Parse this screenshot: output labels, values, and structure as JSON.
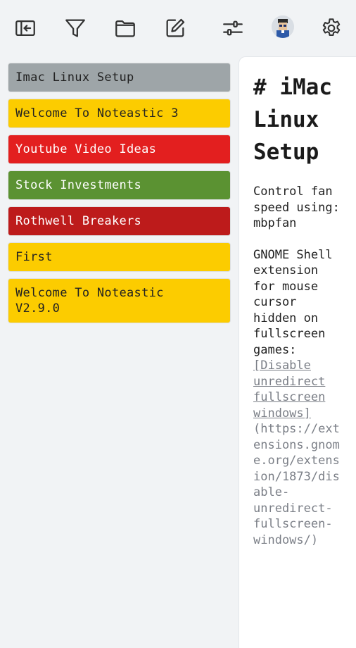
{
  "toolbar": {
    "icons": [
      "sidebar-collapse-icon",
      "filter-icon",
      "folder-icon",
      "edit-note-icon",
      "sliders-icon",
      "avatar",
      "gear-icon"
    ],
    "icon_color": "#333333"
  },
  "notes": [
    {
      "title": "Imac Linux Setup",
      "color": "#9ea5a8",
      "text_color": "#222222"
    },
    {
      "title": "Welcome To Noteastic 3",
      "color": "#fccc00",
      "text_color": "#222222"
    },
    {
      "title": "Youtube Video Ideas",
      "color": "#e31f1f",
      "text_color": "#ffffff"
    },
    {
      "title": "Stock Investments",
      "color": "#5b9232",
      "text_color": "#ffffff"
    },
    {
      "title": "Rothwell Breakers",
      "color": "#bd1b1b",
      "text_color": "#ffffff"
    },
    {
      "title": "First",
      "color": "#fccc00",
      "text_color": "#222222"
    },
    {
      "title": "Welcome To Noteastic\nV2.9.0",
      "color": "#fccc00",
      "text_color": "#222222"
    }
  ],
  "detail": {
    "heading": "# iMac Linux Setup",
    "para1": "Control fan speed using: mbpfan",
    "para2_text": "GNOME Shell extension for mouse cursor hidden on fullscreen games:",
    "link_text": "[Disable unredirect fullscreen windows]",
    "url_text": "(https://extensions.gnome.org/extension/1873/disable-unredirect-fullscreen-windows/)"
  }
}
